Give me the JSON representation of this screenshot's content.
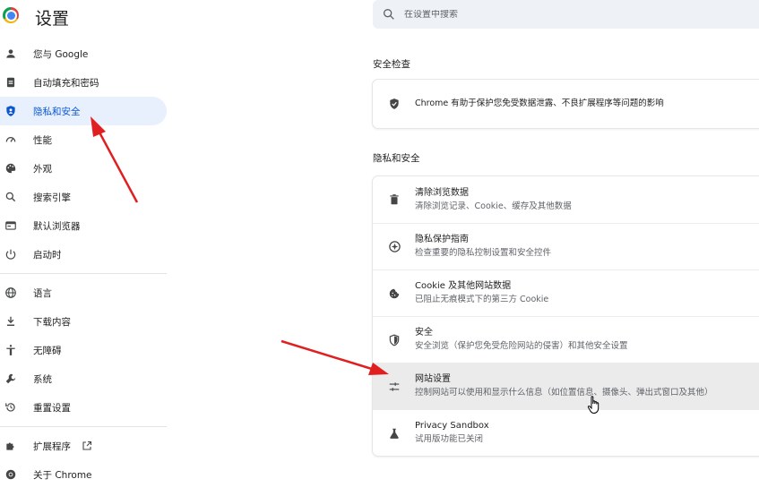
{
  "header": {
    "title": "设置"
  },
  "search": {
    "placeholder": "在设置中搜索",
    "icon": "search-icon"
  },
  "sidebar": {
    "items": [
      {
        "label": "您与 Google",
        "icon": "person-icon"
      },
      {
        "label": "自动填充和密码",
        "icon": "clipboard-icon"
      },
      {
        "label": "隐私和安全",
        "icon": "shield-icon",
        "active": true
      },
      {
        "label": "性能",
        "icon": "gauge-icon"
      },
      {
        "label": "外观",
        "icon": "palette-icon"
      },
      {
        "label": "搜索引擎",
        "icon": "search-icon"
      },
      {
        "label": "默认浏览器",
        "icon": "browser-icon"
      },
      {
        "label": "启动时",
        "icon": "power-icon"
      },
      {
        "label": "语言",
        "icon": "globe-icon"
      },
      {
        "label": "下载内容",
        "icon": "download-icon"
      },
      {
        "label": "无障碍",
        "icon": "accessibility-icon"
      },
      {
        "label": "系统",
        "icon": "wrench-icon"
      },
      {
        "label": "重置设置",
        "icon": "reset-icon"
      },
      {
        "label": "扩展程序",
        "icon": "puzzle-icon"
      },
      {
        "label": "关于 Chrome",
        "icon": "chrome-icon"
      }
    ]
  },
  "safety_check": {
    "title": "安全检查",
    "text": "Chrome 有助于保护您免受数据泄露、不良扩展程序等问题的影响"
  },
  "privacy": {
    "title": "隐私和安全",
    "rows": [
      {
        "title": "清除浏览数据",
        "subtitle": "清除浏览记录、Cookie、缓存及其他数据",
        "icon": "trash-icon"
      },
      {
        "title": "隐私保护指南",
        "subtitle": "检查重要的隐私控制设置和安全控件",
        "icon": "compass-icon"
      },
      {
        "title": "Cookie 及其他网站数据",
        "subtitle": "已阻止无痕模式下的第三方 Cookie",
        "icon": "cookie-icon"
      },
      {
        "title": "安全",
        "subtitle": "安全浏览（保护您免受危险网站的侵害）和其他安全设置",
        "icon": "shield-icon"
      },
      {
        "title": "网站设置",
        "subtitle": "控制网站可以使用和显示什么信息（如位置信息、摄像头、弹出式窗口及其他）",
        "icon": "tune-icon",
        "hovered": true
      },
      {
        "title": "Privacy Sandbox",
        "subtitle": "试用版功能已关闭",
        "icon": "flask-icon"
      }
    ]
  },
  "colors": {
    "accent": "#0b57d0",
    "active_bg": "#e8f0fe",
    "arrow": "#e02020"
  }
}
